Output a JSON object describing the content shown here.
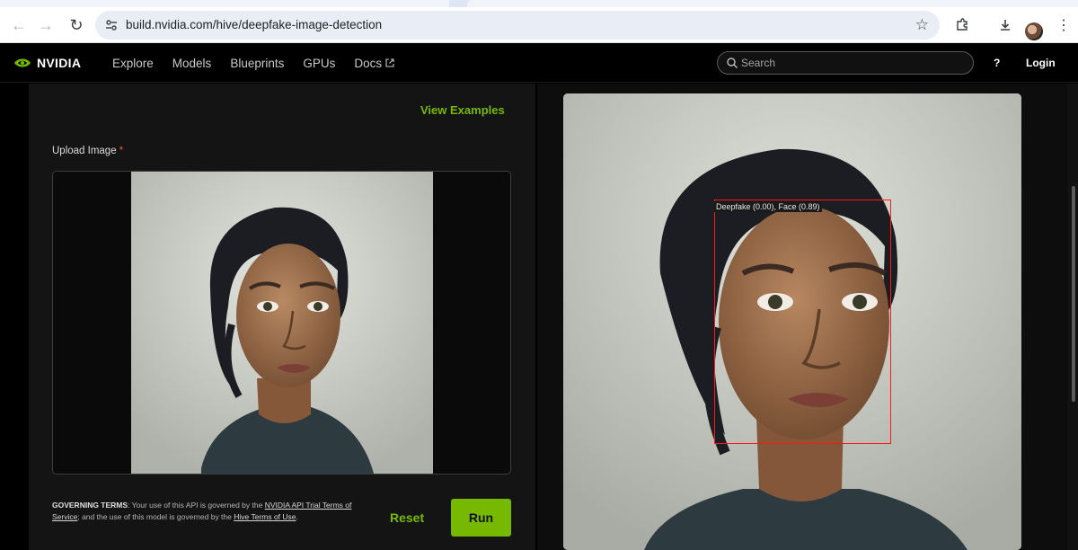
{
  "browser": {
    "url": "build.nvidia.com/hive/deepfake-image-detection"
  },
  "header": {
    "logo_text": "NVIDIA",
    "nav": [
      "Explore",
      "Models",
      "Blueprints",
      "GPUs",
      "Docs"
    ],
    "search_placeholder": "Search",
    "help": "?",
    "login": "Login"
  },
  "left": {
    "view_examples": "View Examples",
    "upload_label": "Upload Image",
    "required_mark": "*",
    "terms": {
      "bold": "GOVERNING TERMS",
      "t1": ": Your use of this API is governed by the ",
      "link1": "NVIDIA API Trial Terms of Service",
      "t2": "; and the use of this model is governed by the ",
      "link2": "Hive Terms of Use",
      "t3": "."
    },
    "reset": "Reset",
    "run": "Run"
  },
  "result": {
    "label": "Deepfake (0.00), Face (0.89)"
  },
  "colors": {
    "accent": "#76b900",
    "detect_box": "#ff1a1a"
  }
}
